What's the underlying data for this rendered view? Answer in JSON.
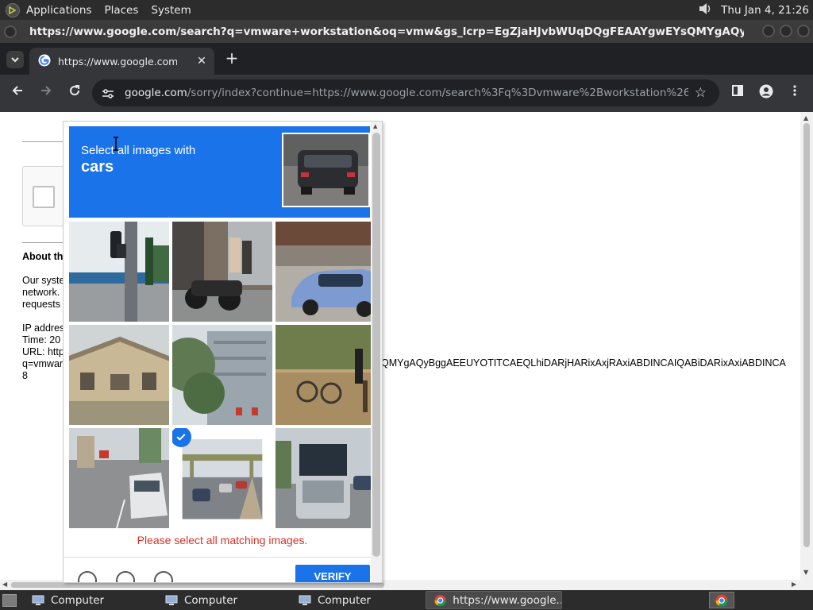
{
  "topbar": {
    "menus": [
      "Applications",
      "Places",
      "System"
    ],
    "clock": "Thu Jan  4, 21:26"
  },
  "window": {
    "title": "https://www.google.com/search?q=vmware+workstation&oq=vmw&gs_lcrp=EgZjaHJvbWUqDQgFEAAYgwEYsQMYgAQyBggAEEUYOTITCAEQ..."
  },
  "tab": {
    "title": "https://www.google.com/sear",
    "close": "✕",
    "new": "+"
  },
  "toolbar": {
    "url_host": "google.com",
    "url_path": "/sorry/index?continue=https://www.google.com/search%3Fq%3Dvmware%2Bworkstation%26oq..."
  },
  "page": {
    "about_heading": "About th",
    "para1": [
      "Our syste",
      "network.",
      "requests"
    ],
    "para2": [
      "IP addres",
      "Time: 20",
      "URL: http",
      "q=vmwar",
      "8"
    ],
    "long_url_fragment": "QMYgAQyBggAEEUYOTITCAEQLhiDARjHARixAxjRAxiABDINCAIQABiDARixAxiABDINCA"
  },
  "captcha": {
    "instruction_line1": "Select all images with",
    "instruction_line2": "cars",
    "error": "Please select all matching images.",
    "verify": "VERIFY",
    "tiles": [
      {
        "name": "traffic-light-street",
        "selected": false
      },
      {
        "name": "motorcycles-doorway",
        "selected": false
      },
      {
        "name": "blue-car-parked",
        "selected": false
      },
      {
        "name": "house-building",
        "selected": false
      },
      {
        "name": "tree-building-traffic-light",
        "selected": false
      },
      {
        "name": "bicycles-park",
        "selected": false
      },
      {
        "name": "street-white-van",
        "selected": false
      },
      {
        "name": "highway-cars",
        "selected": true
      },
      {
        "name": "bus-front",
        "selected": false
      }
    ]
  },
  "taskbar": {
    "items": [
      "Computer",
      "Computer",
      "Computer",
      "https://www.google..."
    ]
  },
  "colors": {
    "captcha_blue": "#1a73e8",
    "error_red": "#d93025",
    "chrome_dark": "#35363a"
  }
}
